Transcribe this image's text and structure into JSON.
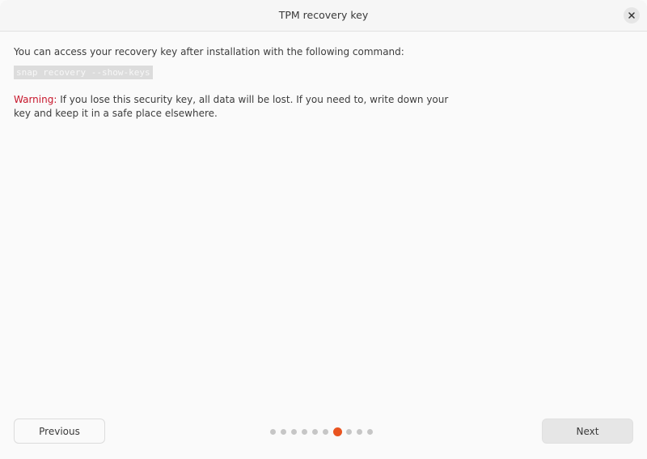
{
  "window": {
    "title": "TPM recovery key",
    "close_icon": "close-icon"
  },
  "content": {
    "intro": "You can access your recovery key after installation with the following command:",
    "command": "snap recovery --show-keys",
    "warning_label": "Warning:",
    "warning_text": " If you lose this security key, all data will be lost. If you need to, write down your key and keep it in a safe place elsewhere.",
    "warning_color": "#c7162b"
  },
  "footer": {
    "previous_label": "Previous",
    "next_label": "Next",
    "progress": {
      "total_steps": 10,
      "current_step": 7,
      "active_color": "#e95420",
      "inactive_color": "#c6c6c6"
    }
  }
}
